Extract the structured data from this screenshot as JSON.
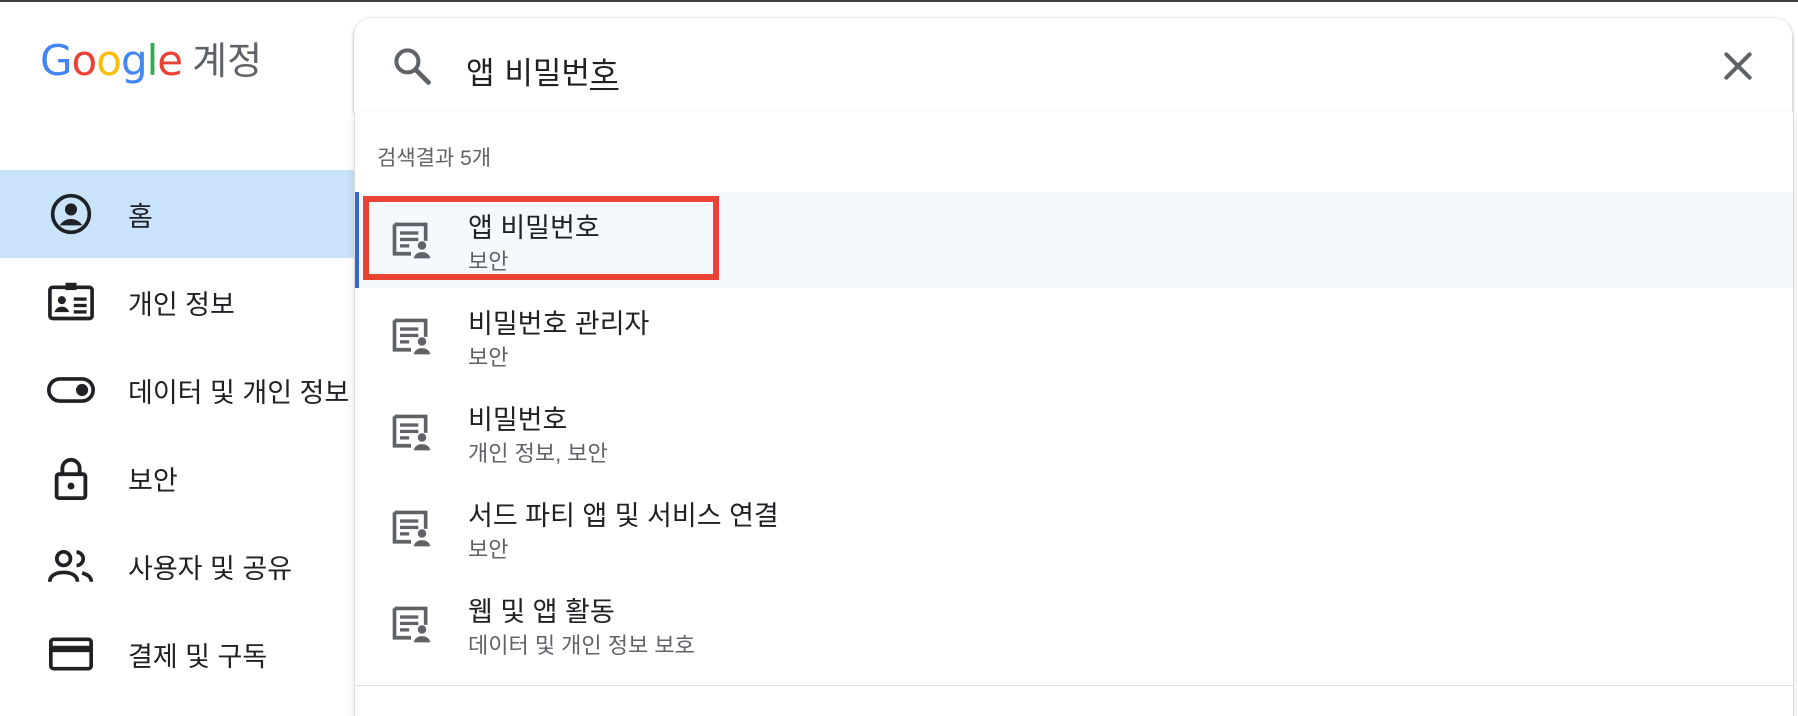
{
  "header": {
    "logo_letters": [
      "G",
      "o",
      "o",
      "g",
      "l",
      "e"
    ],
    "logo_colors": [
      "#4285f4",
      "#ea4335",
      "#fbbc05",
      "#4285f4",
      "#34a853",
      "#ea4335"
    ],
    "product": "계정"
  },
  "sidebar": {
    "items": [
      {
        "label": "홈",
        "icon": "account-circle-icon",
        "active": true
      },
      {
        "label": "개인 정보",
        "icon": "id-card-icon",
        "active": false
      },
      {
        "label": "데이터 및 개인 정보 보호",
        "icon": "toggle-icon",
        "active": false
      },
      {
        "label": "보안",
        "icon": "lock-icon",
        "active": false
      },
      {
        "label": "사용자 및 공유",
        "icon": "people-icon",
        "active": false
      },
      {
        "label": "결제 및 구독",
        "icon": "credit-card-icon",
        "active": false
      }
    ]
  },
  "search": {
    "value": "앱 비밀번호",
    "value_main": "앱 비밀번",
    "value_composing": "호",
    "search_icon": "search-icon",
    "clear_icon": "close-icon"
  },
  "results": {
    "count_label": "검색결과 5개",
    "items": [
      {
        "title": "앱 비밀번호",
        "subtitle": "보안",
        "icon": "setting-page-icon",
        "highlighted": true
      },
      {
        "title": "비밀번호 관리자",
        "subtitle": "보안",
        "icon": "setting-page-icon",
        "highlighted": false
      },
      {
        "title": "비밀번호",
        "subtitle": "개인 정보, 보안",
        "icon": "setting-page-icon",
        "highlighted": false
      },
      {
        "title": "서드 파티 앱 및 서비스 연결",
        "subtitle": "보안",
        "icon": "setting-page-icon",
        "highlighted": false
      },
      {
        "title": "웹 및 앱 활동",
        "subtitle": "데이터 및 개인 정보 보호",
        "icon": "setting-page-icon",
        "highlighted": false
      }
    ]
  },
  "colors": {
    "active_nav": "#c9e3fb",
    "highlight_row": "#f5f8fd",
    "accent": "#3367d6",
    "annotation_red": "#ea4335"
  }
}
